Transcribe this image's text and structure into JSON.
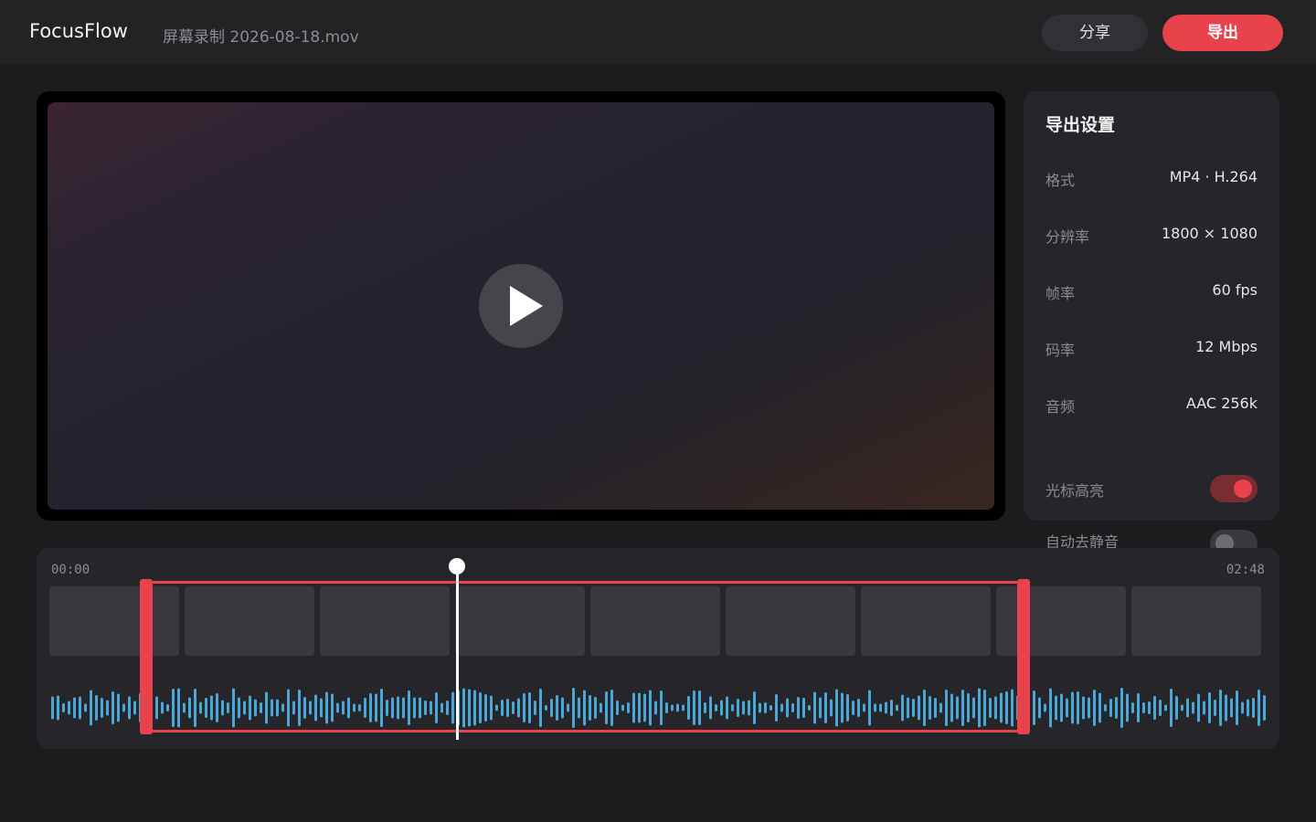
{
  "header": {
    "app_name": "FocusFlow",
    "file_name": "屏幕录制 2026-08-18.mov",
    "share_label": "分享",
    "export_label": "导出"
  },
  "preview": {
    "play_icon": "play-icon"
  },
  "settings": {
    "title": "导出设置",
    "rows": [
      {
        "label": "格式",
        "value": "MP4 · H.264"
      },
      {
        "label": "分辨率",
        "value": "1800 × 1080"
      },
      {
        "label": "帧率",
        "value": "60 fps"
      },
      {
        "label": "码率",
        "value": "12 Mbps"
      },
      {
        "label": "音频",
        "value": "AAC 256k"
      }
    ],
    "toggles": [
      {
        "label": "光标高亮",
        "on": true
      },
      {
        "label": "自动去静音",
        "on": false
      }
    ]
  },
  "timeline": {
    "start_time": "00:00",
    "end_time": "02:48",
    "thumbnail_count": 9
  },
  "colors": {
    "accent": "#e8434c",
    "waveform": "#4aa8d8",
    "background": "#1c1c1f",
    "panel": "#26262a"
  }
}
